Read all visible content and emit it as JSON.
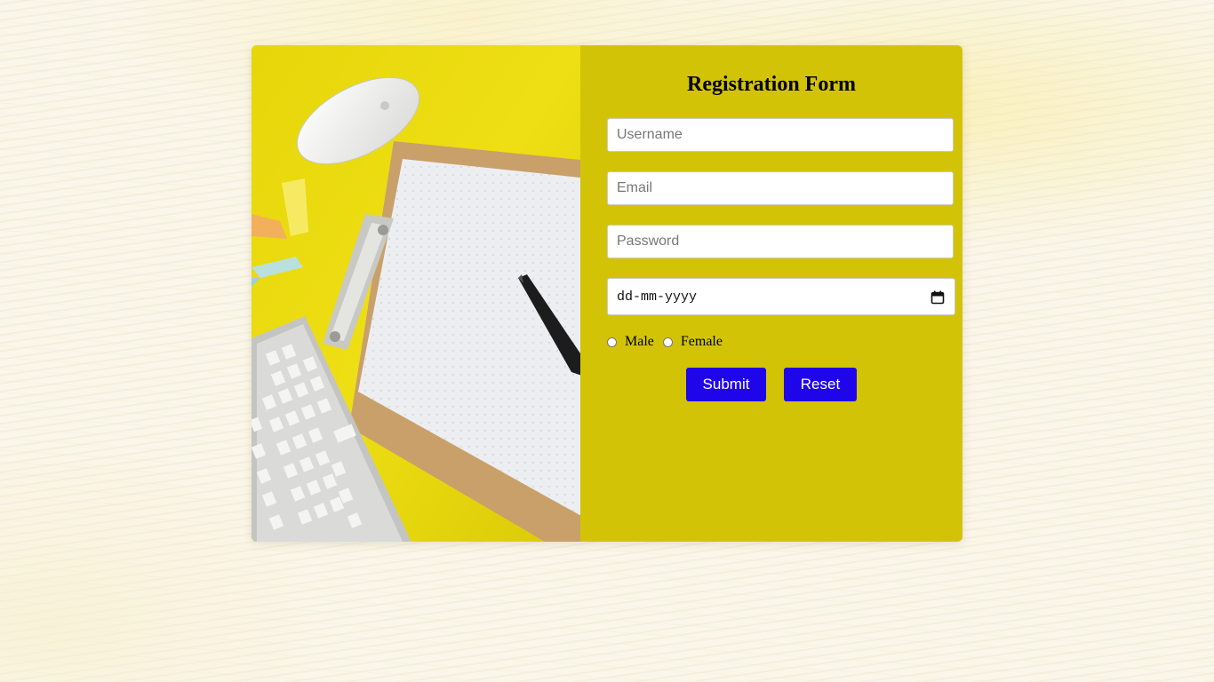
{
  "form": {
    "title": "Registration Form",
    "username_placeholder": "Username",
    "email_placeholder": "Email",
    "password_placeholder": "Password",
    "date_placeholder": "dd-mm-yyyy",
    "gender_options": [
      "Male",
      "Female"
    ],
    "submit_label": "Submit",
    "reset_label": "Reset"
  },
  "colors": {
    "panel_background": "#d3c306",
    "button_background": "#1f06ea",
    "button_text": "#ffffff"
  },
  "icons": {
    "date_picker": "calendar-icon"
  }
}
